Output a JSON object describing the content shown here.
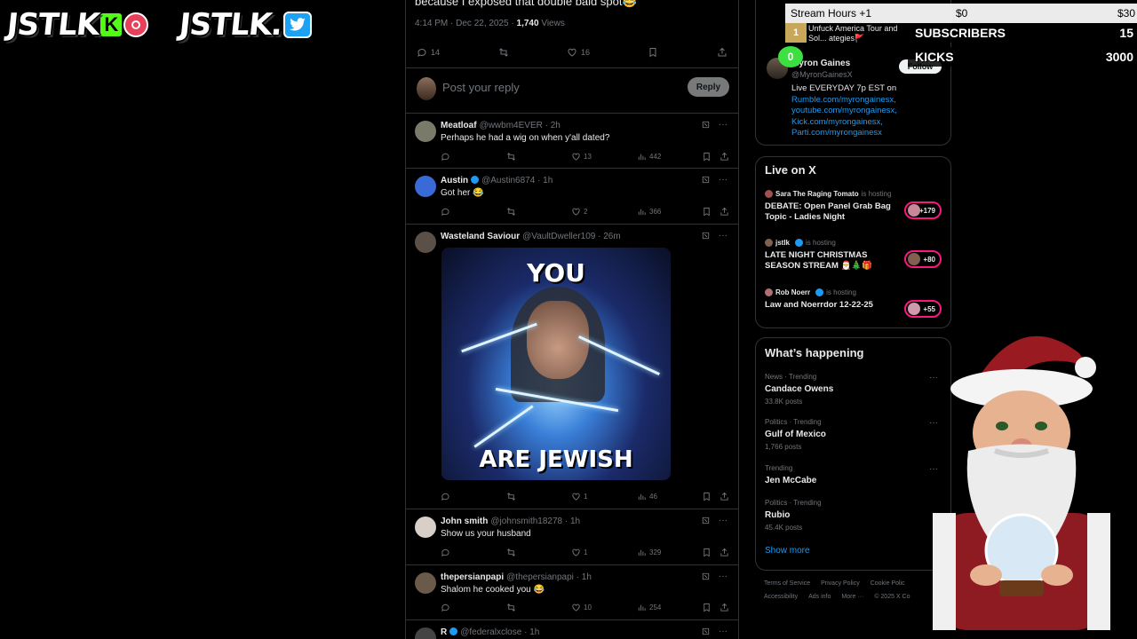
{
  "brand": {
    "kick_logo_text": "JSTLK",
    "kick_badge": "K",
    "twitter_logo_text": "JSTLK."
  },
  "top_tweet": {
    "text_fragment": "because I exposed that double bald spot😂",
    "time": "4:14 PM · Dec 22, 2025 ·",
    "views_count": "1,740",
    "views_label": "Views",
    "replies": "14",
    "likes": "16"
  },
  "reply_box": {
    "placeholder": "Post your reply",
    "button": "Reply"
  },
  "tweets": [
    {
      "name": "Meatloaf",
      "handle": "@wwbm4EVER · 2h",
      "verified": false,
      "text": "Perhaps he had a wig on when y'all dated?",
      "likes": "13",
      "views": "442",
      "avatar_color": "#7a7a6a"
    },
    {
      "name": "Austin",
      "handle": "@Austin6874 · 1h",
      "verified": true,
      "text": "Got her 😂",
      "likes": "2",
      "views": "366",
      "avatar_color": "#3a6ad8"
    },
    {
      "name": "Wasteland Saviour",
      "handle": "@VaultDweller109 · 26m",
      "verified": false,
      "text": "",
      "likes": "1",
      "views": "46",
      "avatar_color": "#5a5048",
      "meme_top": "YOU",
      "meme_bottom": "ARE JEWISH"
    },
    {
      "name": "John smith",
      "handle": "@johnsmith18278 · 1h",
      "verified": false,
      "text": "Show us your husband",
      "likes": "1",
      "views": "329",
      "avatar_color": "#d8d0c8"
    },
    {
      "name": "thepersianpapi",
      "handle": "@thepersianpapi · 1h",
      "verified": false,
      "text": "Shalom he cooked you 😂",
      "likes": "10",
      "views": "254",
      "avatar_color": "#6a5a4a"
    },
    {
      "name": "R",
      "handle": "@federalxclose · 1h",
      "verified": true,
      "text": "",
      "likes": "",
      "views": "",
      "avatar_color": "#444"
    }
  ],
  "follow_card": {
    "name": "Myron Gaines",
    "handle": "@MyronGainesX",
    "follow": "Follow",
    "bio_intro": "Live EVERYDAY 7p EST on",
    "links": [
      "Rumble.com/myrongainesx,",
      "youtube.com/myrongainesx,",
      "Kick.com/myrongainesx,",
      "Parti.com/myrongainesx"
    ]
  },
  "live_on_x": {
    "title": "Live on X",
    "hosting_label": "is hosting",
    "items": [
      {
        "host": "Sara The Raging Tomato",
        "verified": false,
        "title": "DEBATE: Open Panel Grab Bag Topic - Ladies Night",
        "count": "+179"
      },
      {
        "host": "jstlk",
        "verified": true,
        "title": "LATE NIGHT CHRISTMAS SEASON STREAM 🎅🎄🎁",
        "count": "+80"
      },
      {
        "host": "Rob Noerr",
        "verified": true,
        "title": "Law and Noerrdor 12-22-25",
        "count": "+55"
      }
    ]
  },
  "whats_happening": {
    "title": "What’s happening",
    "trends": [
      {
        "category": "News · Trending",
        "name": "Candace Owens",
        "posts": "33.8K posts"
      },
      {
        "category": "Politics · Trending",
        "name": "Gulf of Mexico",
        "posts": "1,766 posts"
      },
      {
        "category": "Trending",
        "name": "Jen McCabe",
        "posts": ""
      },
      {
        "category": "Politics · Trending",
        "name": "Rubio",
        "posts": "45.4K posts"
      }
    ],
    "show_more": "Show more"
  },
  "footer": {
    "links": [
      "Terms of Service",
      "Privacy Policy",
      "Cookie Polic",
      "Accessibility",
      "Ads info",
      "More ···",
      "© 2025 X Co"
    ]
  },
  "overlay": {
    "hours_label": "Stream Hours +1",
    "hours_min": "$0",
    "hours_max": "$30",
    "goal_num": "1",
    "goal_text": "Unfuck America Tour and Sol... ategies🚩",
    "subs_label": "SUBSCRIBERS",
    "subs_value": "15",
    "kicks_label": "KICKS",
    "kicks_value": "3000",
    "zero": "0"
  },
  "colors": {
    "accent": "#1d9bf0",
    "kick_green": "#53fc18",
    "live_ring": "#f91880"
  }
}
